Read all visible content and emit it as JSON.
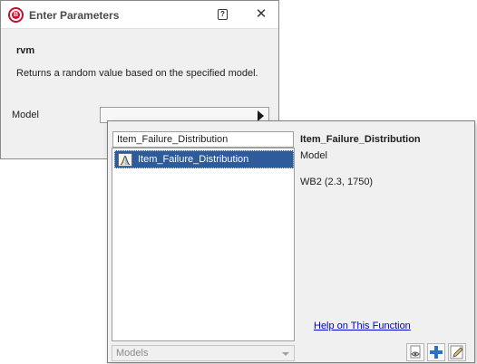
{
  "dialog": {
    "title": "Enter Parameters",
    "help_glyph": "?",
    "close_glyph": "✕",
    "app_icon_letter": "B",
    "function_name": "rvm",
    "function_description": "Returns a random value based on the specified model.",
    "model_label": "Model",
    "model_value": ""
  },
  "popup": {
    "search_value": "Item_Failure_Distribution",
    "list_items": [
      {
        "label": "Item_Failure_Distribution",
        "selected": true
      }
    ],
    "models_dropdown_label": "Models",
    "detail": {
      "title": "Item_Failure_Distribution",
      "type": "Model",
      "value": "WB2 (2.3, 1750)"
    },
    "help_link": "Help on This Function"
  },
  "icons": {
    "app": "reliasoft-logo-icon",
    "help": "help-icon",
    "close": "close-icon",
    "combo_arrow": "play-arrow-icon",
    "distribution": "distribution-icon",
    "view_model": "view-model-icon",
    "add": "add-icon",
    "edit": "edit-icon"
  },
  "colors": {
    "brand": "#c8102e",
    "selection": "#2e5c9a",
    "link": "#0000d6",
    "add_icon": "#2a72c4"
  }
}
